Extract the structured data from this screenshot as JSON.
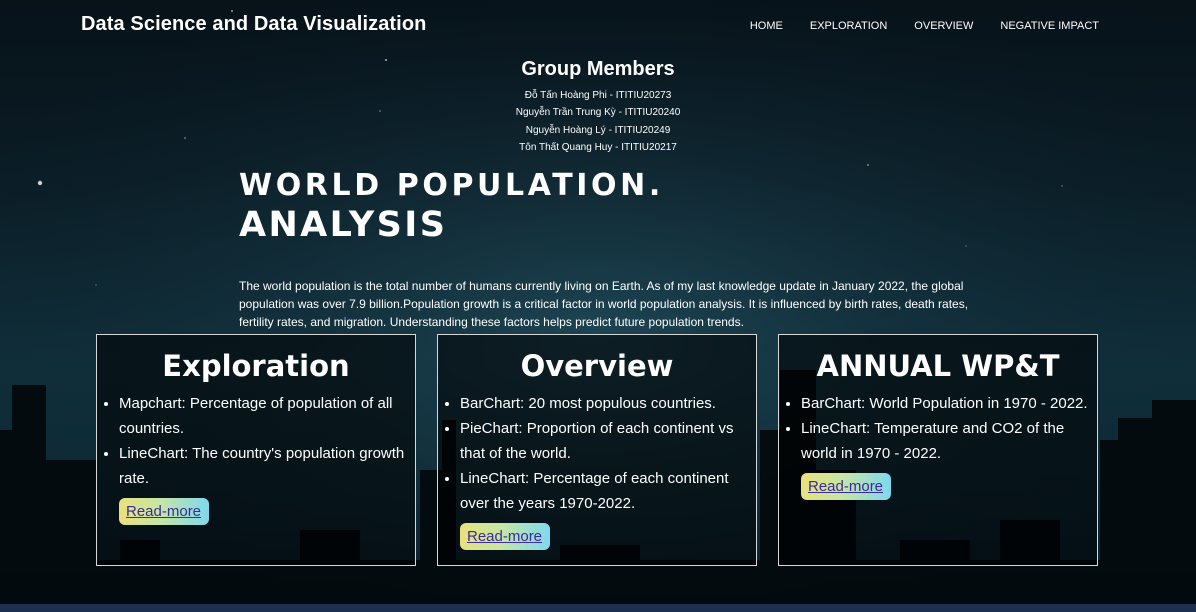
{
  "header": {
    "brand": "Data Science and Data Visualization",
    "nav": [
      "HOME",
      "EXPLORATION",
      "OVERVIEW",
      "NEGATIVE IMPACT"
    ]
  },
  "members": {
    "title": "Group Members",
    "list": [
      "Đỗ Tấn Hoàng Phi - ITITIU20273",
      "Nguyễn Trần Trung Kỳ - ITITIU20240",
      "Nguyễn Hoàng Lý - ITITIU20249",
      "Tôn Thất Quang Huy - ITITIU20217"
    ]
  },
  "hero": {
    "line1": "WORLD POPULATION.",
    "line2": "ANALYSIS",
    "description": "The world population is the total number of humans currently living on Earth. As of my last knowledge update in January 2022, the global population was over 7.9 billion.Population growth is a critical factor in world population analysis. It is influenced by birth rates, death rates, fertility rates, and migration. Understanding these factors helps predict future population trends."
  },
  "cards": [
    {
      "title": "Exploration",
      "items": [
        "Mapchart: Percentage of population of all countries.",
        "LineChart: The country's population growth rate."
      ],
      "button": "Read-more"
    },
    {
      "title": "Overview",
      "items": [
        "BarChart: 20 most populous countries.",
        "PieChart: Proportion of each continent vs that of the world.",
        "LineChart: Percentage of each continent over the years 1970-2022."
      ],
      "button": "Read-more"
    },
    {
      "title": "ANNUAL WP&T",
      "items": [
        "BarChart: World Population in 1970 - 2022.",
        "LineChart: Temperature and CO2 of the world in 1970 - 2022."
      ],
      "button": "Read-more"
    }
  ]
}
